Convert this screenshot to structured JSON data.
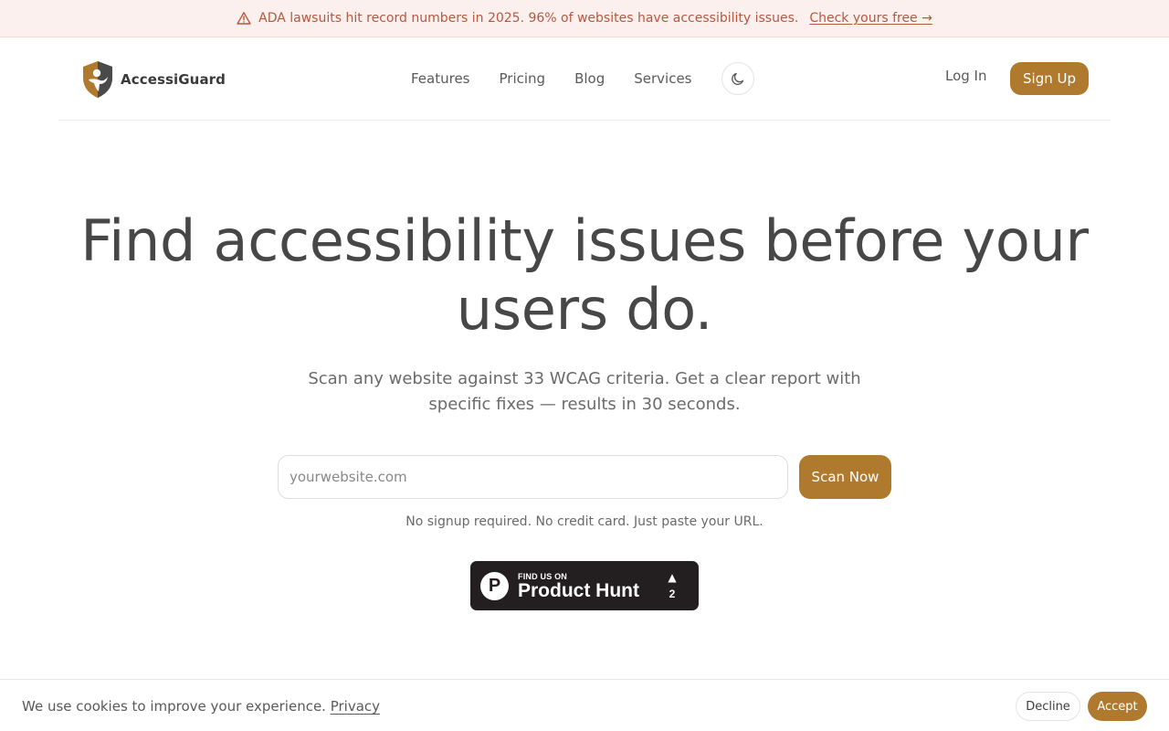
{
  "banner": {
    "icon": "warning-triangle-icon",
    "message": "ADA lawsuits hit record numbers in 2025. 96% of websites have accessibility issues.",
    "link_label": "Check yours free →"
  },
  "header": {
    "brand": "AccessiGuard",
    "logo_icon": "shield-person-icon",
    "nav": [
      {
        "label": "Features"
      },
      {
        "label": "Pricing"
      },
      {
        "label": "Blog"
      },
      {
        "label": "Services"
      }
    ],
    "theme_toggle_icon": "moon-icon",
    "login_label": "Log In",
    "signup_label": "Sign Up"
  },
  "hero": {
    "title_line1": "Find accessibility issues before your",
    "title_line2": "users do.",
    "subtitle_line1": "Scan any website against 33 WCAG criteria. Get a clear report with",
    "subtitle_line2": "specific fixes — results in 30 seconds.",
    "input_placeholder": "yourwebsite.com",
    "input_value": "",
    "scan_label": "Scan Now",
    "note": "No signup required. No credit card. Just paste your URL."
  },
  "product_hunt": {
    "logo_letter": "P",
    "kicker": "FIND US ON",
    "name": "Product Hunt",
    "upvote_icon": "▲",
    "count": "2"
  },
  "cookie": {
    "message": "We use cookies to improve your experience.",
    "privacy_label": "Privacy",
    "decline_label": "Decline",
    "accept_label": "Accept"
  },
  "colors": {
    "accent": "#b07a2e",
    "banner_bg": "#fbf0ee",
    "banner_text": "#b5583f",
    "badge_bg": "#231f20"
  }
}
